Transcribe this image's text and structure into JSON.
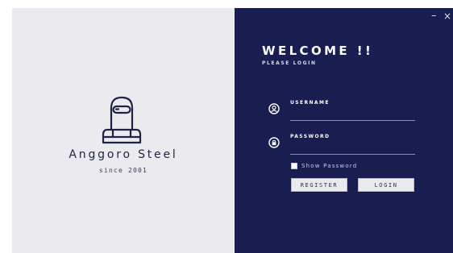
{
  "brand": {
    "name": "Anggoro Steel",
    "since": "since 2001",
    "logo_icon": "welder-mask-icon"
  },
  "window_controls": {
    "minimize": "–",
    "close": "×"
  },
  "login": {
    "title": "WELCOME !!",
    "subtitle": "PLEASE LOGIN",
    "username_label": "USERNAME",
    "username_value": "",
    "username_icon": "user-icon",
    "password_label": "PASSWORD",
    "password_value": "",
    "password_icon": "lock-icon",
    "show_password_label": "Show Password",
    "show_password_checked": false,
    "register_label": "REGISTER",
    "login_label": "LOGIN"
  },
  "colors": {
    "brand_panel_bg": "#ebebef",
    "login_panel_bg": "#181e52",
    "text_light": "#ffffff",
    "button_bg": "#e9e9ee"
  }
}
